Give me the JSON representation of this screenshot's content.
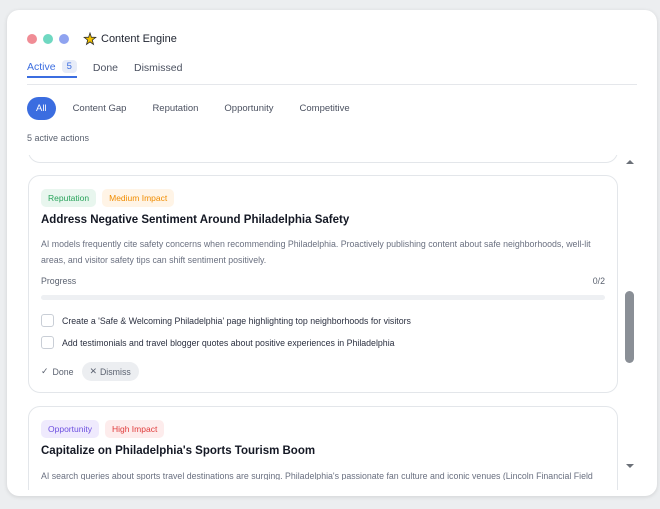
{
  "app": {
    "title": "Content Engine",
    "icon": "sparkle-star-icon"
  },
  "window_controls": [
    "close",
    "minimize",
    "maximize"
  ],
  "tabs": [
    {
      "label": "Active",
      "count": "5"
    },
    {
      "label": "Done"
    },
    {
      "label": "Dismissed"
    }
  ],
  "filters": [
    "All",
    "Content Gap",
    "Reputation",
    "Opportunity",
    "Competitive"
  ],
  "summary": "5 active actions",
  "cards": [
    {
      "badges": [
        "Reputation",
        "Medium Impact"
      ],
      "title": "Address Negative Sentiment Around Philadelphia Safety",
      "description": "AI models frequently cite safety concerns when recommending Philadelphia. Proactively publishing content about safe neighborhoods, well-lit areas, and visitor safety tips can shift sentiment positively.",
      "progress_label": "Progress",
      "progress_count": "0/2",
      "progress_fraction": 0,
      "tasks": [
        "Create a 'Safe & Welcoming Philadelphia' page highlighting top neighborhoods for visitors",
        "Add testimonials and travel blogger quotes about positive experiences in Philadelphia"
      ],
      "done_label": "Done",
      "dismiss_label": "Dismiss"
    },
    {
      "badges": [
        "Opportunity",
        "High Impact"
      ],
      "title": "Capitalize on Philadelphia's Sports Tourism Boom",
      "description": "AI search queries about sports travel destinations are surging. Philadelphia's passionate fan culture and iconic venues (Lincoln Financial Field"
    }
  ],
  "colors": {
    "accent": "#3b6de0",
    "window_bg": "#ffffff",
    "page_bg": "#eceef0"
  }
}
